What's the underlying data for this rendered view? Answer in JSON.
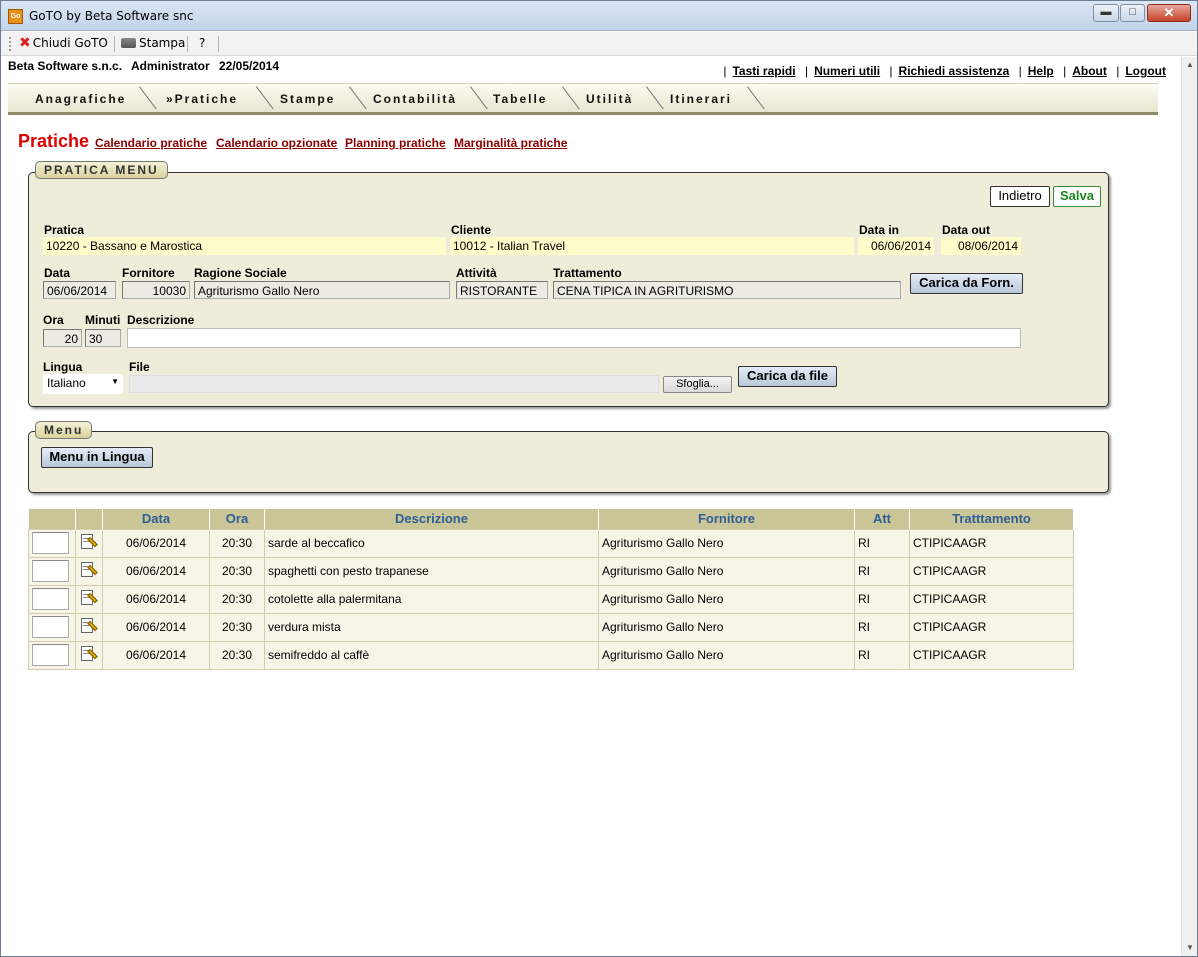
{
  "window": {
    "title": "GoTO by Beta Software snc",
    "app_icon": "Go",
    "min_glyph": "▬",
    "max_glyph": "□",
    "close_glyph": "✕"
  },
  "toolbar": {
    "close_label": "Chiudi GoTO",
    "print_label": "Stampa",
    "help_label": "?"
  },
  "header": {
    "company": "Beta Software s.n.c.",
    "user": "Administrator",
    "date": "22/05/2014",
    "links": [
      "Tasti rapidi",
      "Numeri utili",
      "Richiedi assistenza",
      "Help",
      "About",
      "Logout"
    ],
    "separator": "|"
  },
  "nav": {
    "items": [
      "Anagrafiche",
      "»Pratiche",
      "Stampe",
      "Contabilità",
      "Tabelle",
      "Utilità",
      "Itinerari"
    ]
  },
  "page": {
    "title": "Pratiche",
    "sublinks": [
      "Calendario pratiche",
      "Calendario opzionate",
      "Planning pratiche",
      "Marginalità pratiche"
    ]
  },
  "pratica_menu": {
    "legend": "PRATICA MENU",
    "back_label": "Indietro",
    "save_label": "Salva",
    "labels": {
      "pratica": "Pratica",
      "cliente": "Cliente",
      "data_in": "Data in",
      "data_out": "Data out",
      "data": "Data",
      "fornitore": "Fornitore",
      "ragione_sociale": "Ragione Sociale",
      "attivita": "Attività",
      "trattamento": "Trattamento",
      "ora": "Ora",
      "minuti": "Minuti",
      "descrizione": "Descrizione",
      "lingua": "Lingua",
      "file": "File"
    },
    "values": {
      "pratica": "10220 - Bassano e Marostica",
      "cliente": "10012 - Italian Travel",
      "data_in": "06/06/2014",
      "data_out": "08/06/2014",
      "data": "06/06/2014",
      "fornitore": "10030",
      "ragione_sociale": "Agriturismo Gallo Nero",
      "attivita": "RISTORANTE",
      "trattamento": "CENA TIPICA IN AGRITURISMO",
      "ora": "20",
      "minuti": "30",
      "descrizione": "",
      "lingua": "Italiano",
      "file": ""
    },
    "load_supplier_label": "Carica da Forn.",
    "browse_label": "Sfoglia...",
    "load_file_label": "Carica da file"
  },
  "menu_box": {
    "legend": "Menu",
    "button_label": "Menu in Lingua"
  },
  "table": {
    "headers": [
      "Data",
      "Ora",
      "Descrizione",
      "Fornitore",
      "Att",
      "Tratttamento"
    ],
    "rows": [
      {
        "data": "06/06/2014",
        "ora": "20:30",
        "descrizione": "sarde al beccafico",
        "fornitore": "Agriturismo Gallo Nero",
        "att": "RI",
        "trattamento": "CTIPICAAGR"
      },
      {
        "data": "06/06/2014",
        "ora": "20:30",
        "descrizione": "spaghetti con pesto trapanese",
        "fornitore": "Agriturismo Gallo Nero",
        "att": "RI",
        "trattamento": "CTIPICAAGR"
      },
      {
        "data": "06/06/2014",
        "ora": "20:30",
        "descrizione": "cotolette alla palermitana",
        "fornitore": "Agriturismo Gallo Nero",
        "att": "RI",
        "trattamento": "CTIPICAAGR"
      },
      {
        "data": "06/06/2014",
        "ora": "20:30",
        "descrizione": "verdura mista",
        "fornitore": "Agriturismo Gallo Nero",
        "att": "RI",
        "trattamento": "CTIPICAAGR"
      },
      {
        "data": "06/06/2014",
        "ora": "20:30",
        "descrizione": "semifreddo al caffè",
        "fornitore": "Agriturismo Gallo Nero",
        "att": "RI",
        "trattamento": "CTIPICAAGR"
      }
    ]
  },
  "scrollbar": {
    "up": "▲",
    "down": "▼"
  }
}
